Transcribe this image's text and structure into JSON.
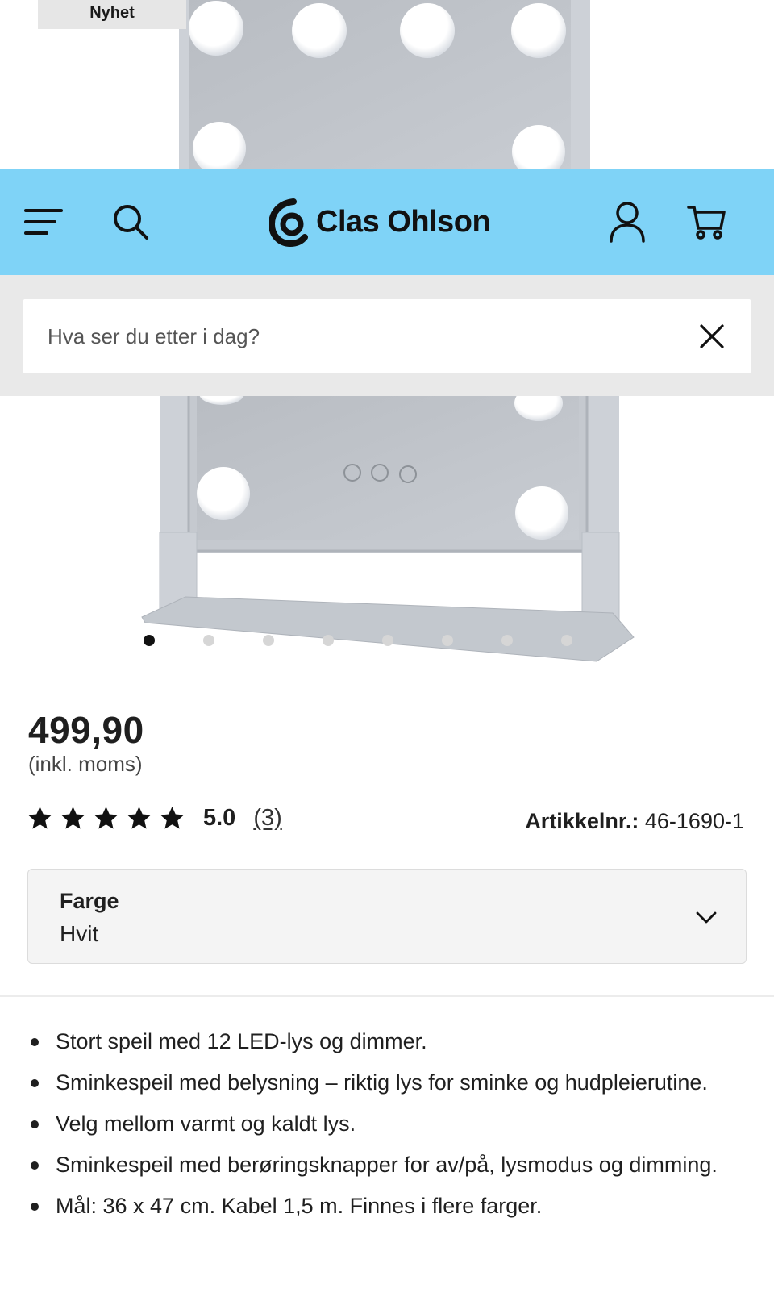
{
  "product": {
    "badge": "Nyhet",
    "image_alt": "Sminkespeil med LED-lys",
    "carousel_count": 8,
    "carousel_active": 1,
    "price": "499,90",
    "vat_note": "(inkl. moms)",
    "rating_value": "5.0",
    "rating_stars": 5,
    "review_count": "(3)",
    "article_label": "Artikkelnr.:",
    "article_number": "46-1690-1",
    "option": {
      "label": "Farge",
      "value": "Hvit"
    },
    "features": [
      "Stort speil med 12 LED-lys og dimmer.",
      "Sminkespeil med belysning – riktig lys for sminke og hudpleierutine.",
      "Velg mellom varmt og kaldt lys.",
      "Sminkespeil med berøringsknapper for av/på, lysmodus og dimming.",
      "Mål: 36 x 47 cm. Kabel 1,5 m. Finnes i flere farger."
    ]
  },
  "header": {
    "brand": "Clas Ohlson",
    "menu_icon": "hamburger-icon",
    "search_icon": "search-icon",
    "account_icon": "user-icon",
    "cart_icon": "cart-icon",
    "background_color": "#7fd3f7"
  },
  "search": {
    "placeholder": "Hva ser du etter i dag?",
    "value": "",
    "clear_icon": "close-icon"
  }
}
